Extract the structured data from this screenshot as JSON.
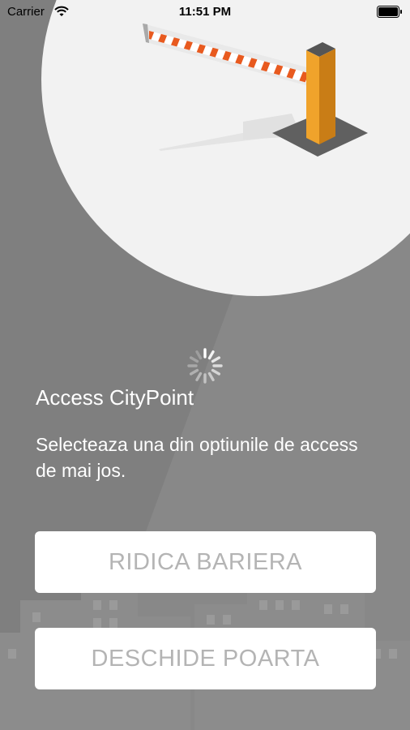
{
  "status_bar": {
    "carrier": "Carrier",
    "time": "11:51 PM",
    "wifi_icon": "wifi-icon",
    "battery_icon": "battery-icon"
  },
  "header": {
    "title": "Access CityPoint",
    "subtitle": "Selecteaza una din optiunile de access de mai jos."
  },
  "actions": {
    "raise_barrier_label": "RIDICA BARIERA",
    "open_gate_label": "DESCHIDE POARTA"
  },
  "icons": {
    "loading": "spinner-icon",
    "illustration": "parking-barrier-illustration"
  },
  "colors": {
    "background": "#7f7f7f",
    "circle": "#f2f2f2",
    "barrier_post": "#f0a32b",
    "barrier_stripe": "#e85a1f",
    "button_bg": "#ffffff",
    "button_text": "#b4b4b4"
  }
}
